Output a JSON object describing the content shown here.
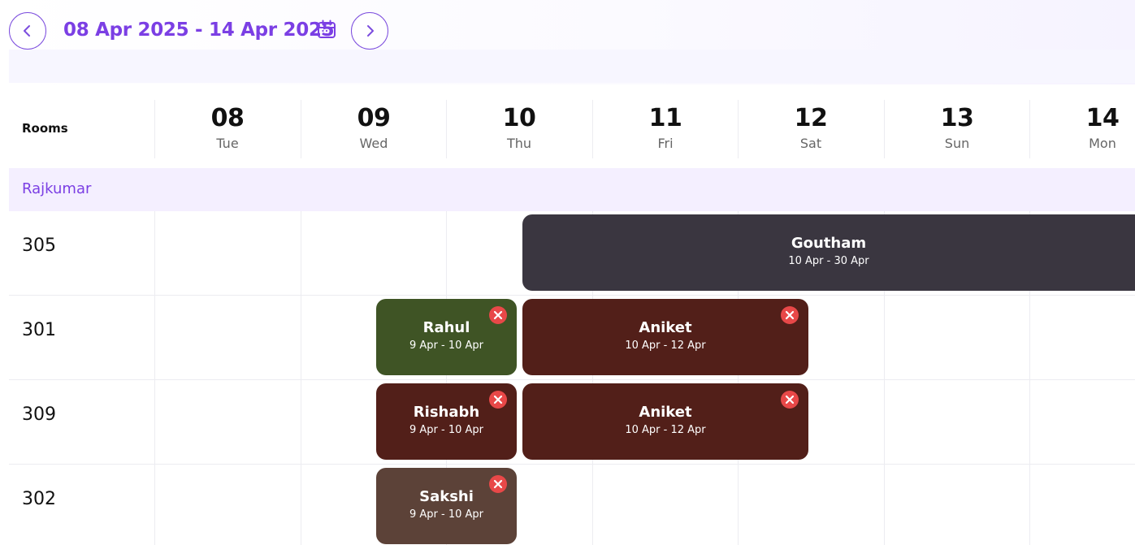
{
  "date_nav": {
    "range_label": "08 Apr 2025 - 14 Apr 2025",
    "prev_icon": "chevron-left-icon",
    "next_icon": "chevron-right-icon",
    "calendar_icon": "calendar-icon"
  },
  "header": {
    "rooms_label": "Rooms",
    "days": [
      {
        "num": "08",
        "name": "Tue"
      },
      {
        "num": "09",
        "name": "Wed"
      },
      {
        "num": "10",
        "name": "Thu"
      },
      {
        "num": "11",
        "name": "Fri"
      },
      {
        "num": "12",
        "name": "Sat"
      },
      {
        "num": "13",
        "name": "Sun"
      },
      {
        "num": "14",
        "name": "Mon"
      }
    ]
  },
  "group": {
    "label": "Rajkumar"
  },
  "rooms": [
    {
      "name": "305"
    },
    {
      "name": "301"
    },
    {
      "name": "309"
    },
    {
      "name": "302"
    }
  ],
  "bookings": [
    {
      "guest": "Goutham",
      "dates": "10 Apr - 30 Apr",
      "color": "#3a3640",
      "removable": false
    },
    {
      "guest": "Rahul",
      "dates": "9 Apr - 10 Apr",
      "color": "#3f5425",
      "removable": true
    },
    {
      "guest": "Aniket",
      "dates": "10 Apr - 12 Apr",
      "color": "#521f19",
      "removable": true
    },
    {
      "guest": "Rishabh",
      "dates": "9 Apr - 10 Apr",
      "color": "#521f19",
      "removable": true
    },
    {
      "guest": "Aniket",
      "dates": "10 Apr - 12 Apr",
      "color": "#521f19",
      "removable": true
    },
    {
      "guest": "Sakshi",
      "dates": "9 Apr - 10 Apr",
      "color": "#5c4238",
      "removable": true
    }
  ],
  "colors": {
    "accent": "#7b3fe4",
    "group_bg": "#f4efff",
    "remove_badge": "#e84848"
  }
}
